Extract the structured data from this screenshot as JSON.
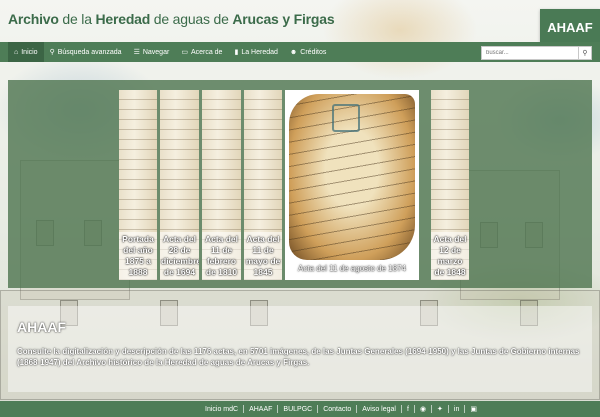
{
  "header": {
    "title_part1": "Archivo",
    "title_part2": " de la ",
    "title_part3": "Heredad",
    "title_part4": " de aguas de ",
    "title_part5": "Arucas y Firgas",
    "logo": "AHAAF"
  },
  "nav": {
    "items": [
      {
        "label": "Inicio",
        "icon": "home-icon",
        "glyph": "⌂"
      },
      {
        "label": "Búsqueda avanzada",
        "icon": "search-icon",
        "glyph": "⚲"
      },
      {
        "label": "Navegar",
        "icon": "list-icon",
        "glyph": "☰"
      },
      {
        "label": "Acerca de",
        "icon": "info-icon",
        "glyph": "▭"
      },
      {
        "label": "La Heredad",
        "icon": "book-icon",
        "glyph": "▮"
      },
      {
        "label": "Créditos",
        "icon": "users-icon",
        "glyph": "☻"
      }
    ],
    "search_placeholder": "buscar...",
    "search_button_glyph": "⚲"
  },
  "carousel": {
    "slides": [
      {
        "caption": "Portada del año 1875 a 1888"
      },
      {
        "caption": "Acta del 28 de diciembre de 1694"
      },
      {
        "caption": "Acta del 11 de febrero de 1810"
      },
      {
        "caption": "Acta del 11 de mayo de 1845"
      },
      {
        "caption": "Acta del 11 de agosto de 1874"
      },
      {
        "caption": "Acta del 12 de marzo de 1848"
      }
    ]
  },
  "intro": {
    "title": "AHAAF",
    "text": "Consulte la digitalización y descripción de las 1176 actas, en 5701 imágenes, de las Juntas Generales (1694-1950) y las Juntas de Gobierno internas (1868-1947) del Archivo histórico de la Heredad de aguas de Arucas y Firgas."
  },
  "footer": {
    "links": [
      "Inicio mdC",
      "AHAAF",
      "BULPGC",
      "Contacto",
      "Aviso legal"
    ],
    "icons": [
      {
        "name": "facebook-icon",
        "glyph": "f"
      },
      {
        "name": "globe-icon",
        "glyph": "◉"
      },
      {
        "name": "twitter-icon",
        "glyph": "✦"
      },
      {
        "name": "linkedin-icon",
        "glyph": "in"
      },
      {
        "name": "image-icon",
        "glyph": "▣"
      }
    ]
  },
  "colors": {
    "brand_green": "#4e7d57",
    "title_green": "#3b6b4a"
  }
}
